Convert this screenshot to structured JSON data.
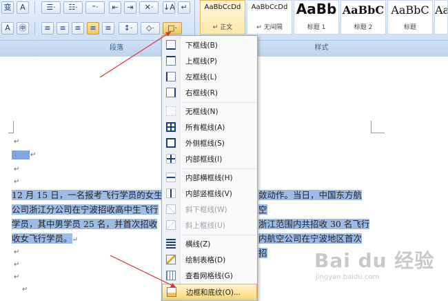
{
  "ribbon": {
    "row1": {
      "font_btn_1": "变",
      "font_btn_2": "A",
      "bullets": "☰·",
      "numbering": "☷·",
      "multilevel": "⁼·",
      "decrease_indent": "⇤",
      "increase_indent": "⇥",
      "chinese_layout": "✕·",
      "sort": "↓A",
      "show_marks": "↵"
    },
    "row2": {
      "char_border": "A",
      "enclose": "㊥",
      "align_left": "≡",
      "center": "≡",
      "align_right": "≡",
      "justify": "≡",
      "distributed": "≡",
      "line_spacing": "↕·",
      "shading": "◇·",
      "borders": "□·"
    },
    "group_label_paragraph": "段落",
    "group_label_styles": "样式",
    "styles": [
      {
        "sample": "AaBbCcDd",
        "name": "↵ 正文",
        "selected": true
      },
      {
        "sample": "AaBbCcDd",
        "name": "↵ 无间隔",
        "selected": false
      },
      {
        "sample": "AaBb",
        "name": "标题 1",
        "selected": false
      },
      {
        "sample": "AaBbC",
        "name": "标题 2",
        "selected": false
      },
      {
        "sample": "AaBbC",
        "name": "标题",
        "selected": false
      },
      {
        "sample": "Aa",
        "name": "",
        "selected": false
      }
    ]
  },
  "border_menu": {
    "items": [
      {
        "label": "下框线(B)",
        "icon": "bottom-border-icon",
        "disabled": false
      },
      {
        "label": "上框线(P)",
        "icon": "top-border-icon",
        "disabled": false
      },
      {
        "label": "左框线(L)",
        "icon": "left-border-icon",
        "disabled": false
      },
      {
        "label": "右框线(R)",
        "icon": "right-border-icon",
        "disabled": false
      },
      {
        "label": "无框线(N)",
        "icon": "no-border-icon",
        "disabled": false
      },
      {
        "label": "所有框线(A)",
        "icon": "all-borders-icon",
        "disabled": false
      },
      {
        "label": "外侧框线(S)",
        "icon": "outside-borders-icon",
        "disabled": false
      },
      {
        "label": "内部框线(I)",
        "icon": "inside-borders-icon",
        "disabled": false
      },
      {
        "label": "内部横框线(H)",
        "icon": "inside-horizontal-border-icon",
        "disabled": false
      },
      {
        "label": "内部竖框线(V)",
        "icon": "inside-vertical-border-icon",
        "disabled": false
      },
      {
        "label": "斜下框线(W)",
        "icon": "diagonal-down-border-icon",
        "disabled": true
      },
      {
        "label": "斜上框线(U)",
        "icon": "diagonal-up-border-icon",
        "disabled": true
      },
      {
        "label": "横线(Z)",
        "icon": "horizontal-line-icon",
        "disabled": false
      },
      {
        "label": "绘制表格(D)",
        "icon": "draw-table-icon",
        "disabled": false
      },
      {
        "label": "查看网格线(G)",
        "icon": "view-gridlines-icon",
        "disabled": false
      },
      {
        "label": "边框和底纹(O)...",
        "icon": "borders-shading-icon",
        "disabled": false
      }
    ]
  },
  "document": {
    "paragraph_lines": [
      "12 月 15 日，一名报考飞行学员的女生",
      "公司浙江分公司在宁波招收高中生飞行",
      "学员，其中男学员 25 名，并首次招收",
      "收女飞行学员。"
    ],
    "paragraph_right_lines": [
      "敛动作。当日，中国东方航空",
      "浙江范围内共招收 30 名飞行",
      "内航空公司在宁波地区首次招"
    ],
    "para_mark": "↵"
  },
  "watermark": {
    "brand": "Bai du 经验",
    "url": "jingyan.baidu.com"
  }
}
